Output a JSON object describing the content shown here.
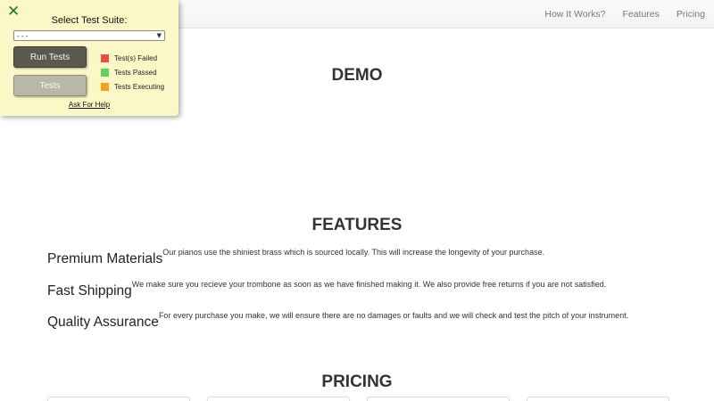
{
  "nav": {
    "links": [
      "How It Works?",
      "Features",
      "Pricing"
    ]
  },
  "demo": {
    "title": "DEMO"
  },
  "features": {
    "title": "FEATURES",
    "items": [
      {
        "name": "Premium Materials",
        "description": "Our pianos use the shiniest brass which is sourced locally. This will increase the longevity of your purchase."
      },
      {
        "name": "Fast Shipping",
        "description": "We make sure you recieve your trombone as soon as we have finished making it. We also provide free returns if you are not satisfied."
      },
      {
        "name": "Quality Assurance",
        "description": "For every purchase you make, we will ensure there are no damages or faults and we will check and test the pitch of your instrument."
      }
    ]
  },
  "pricing": {
    "title": "PRICING"
  },
  "test_panel": {
    "close_icon": "close-icon",
    "heading": "Select Test Suite:",
    "select_value": "- - -",
    "run_button": "Run Tests",
    "tests_button": "Tests",
    "legend": [
      {
        "label": "Test(s) Failed",
        "color": "#e8533f"
      },
      {
        "label": "Tests Passed",
        "color": "#5fd35b"
      },
      {
        "label": "Tests Executing",
        "color": "#f5a11e"
      }
    ],
    "help_link": "Ask For Help"
  }
}
